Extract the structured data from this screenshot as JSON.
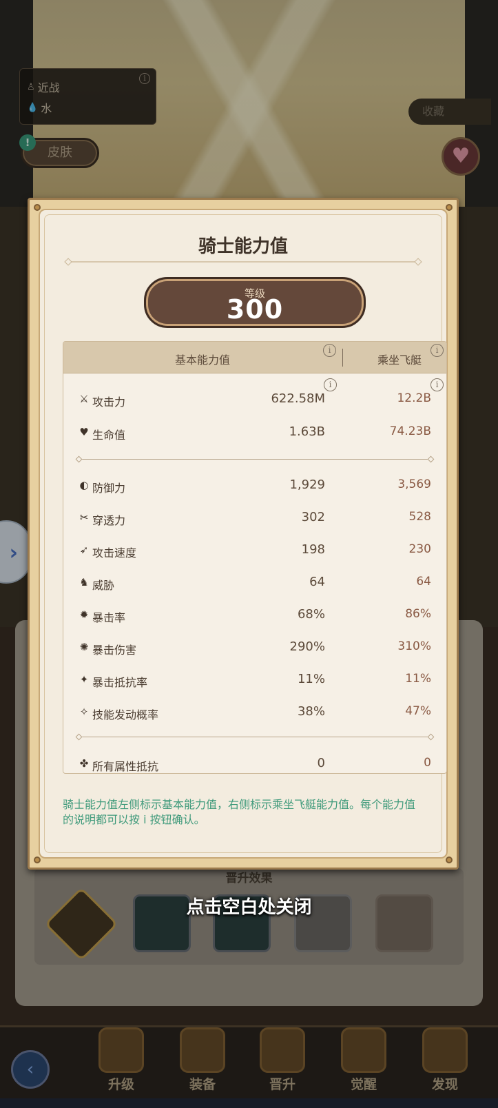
{
  "background": {
    "attack_type": "近战",
    "element": "水",
    "skin_label": "皮肤",
    "alert_glyph": "!",
    "favorite_label": "收藏",
    "promotion_title": "晋升效果",
    "close_hint": "点击空白处关闭",
    "nav": [
      {
        "label": "升级"
      },
      {
        "label": "装备"
      },
      {
        "label": "晋升"
      },
      {
        "label": "觉醒"
      },
      {
        "label": "发现"
      }
    ]
  },
  "modal": {
    "title": "骑士能力值",
    "level_label": "等级",
    "level_value": "300",
    "header": {
      "base": "基本能力值",
      "mount": "乘坐飞艇"
    },
    "info_glyph": "i",
    "stats": [
      {
        "icon": "sword-icon",
        "glyph": "⚔",
        "name": "攻击力",
        "base": "622.58M",
        "mount": "12.2B"
      },
      {
        "icon": "heart-icon",
        "glyph": "♥",
        "name": "生命值",
        "base": "1.63B",
        "mount": "74.23B"
      },
      {
        "icon": "shield-icon",
        "glyph": "◐",
        "name": "防御力",
        "base": "1,929",
        "mount": "3,569"
      },
      {
        "icon": "pierce-icon",
        "glyph": "✂",
        "name": "穿透力",
        "base": "302",
        "mount": "528"
      },
      {
        "icon": "speed-icon",
        "glyph": "➶",
        "name": "攻击速度",
        "base": "198",
        "mount": "230"
      },
      {
        "icon": "threat-icon",
        "glyph": "♞",
        "name": "威胁",
        "base": "64",
        "mount": "64"
      },
      {
        "icon": "crit-rate-icon",
        "glyph": "✹",
        "name": "暴击率",
        "base": "68%",
        "mount": "86%"
      },
      {
        "icon": "crit-damage-icon",
        "glyph": "✺",
        "name": "暴击伤害",
        "base": "290%",
        "mount": "310%"
      },
      {
        "icon": "crit-resist-icon",
        "glyph": "✦",
        "name": "暴击抵抗率",
        "base": "11%",
        "mount": "11%"
      },
      {
        "icon": "skill-chance-icon",
        "glyph": "✧",
        "name": "技能发动概率",
        "base": "38%",
        "mount": "47%"
      },
      {
        "icon": "all-resist-icon",
        "glyph": "✤",
        "name": "所有属性抵抗",
        "base": "0",
        "mount": "0"
      }
    ],
    "footnote": "骑士能力值左侧标示基本能力值，右侧标示乘坐飞艇能力值。每个能力值的说明都可以按 i 按钮确认。"
  },
  "colors": {
    "accent_green": "#3f9a7b",
    "plate_brown": "#64483a",
    "mount_value": "#8a5a44"
  }
}
